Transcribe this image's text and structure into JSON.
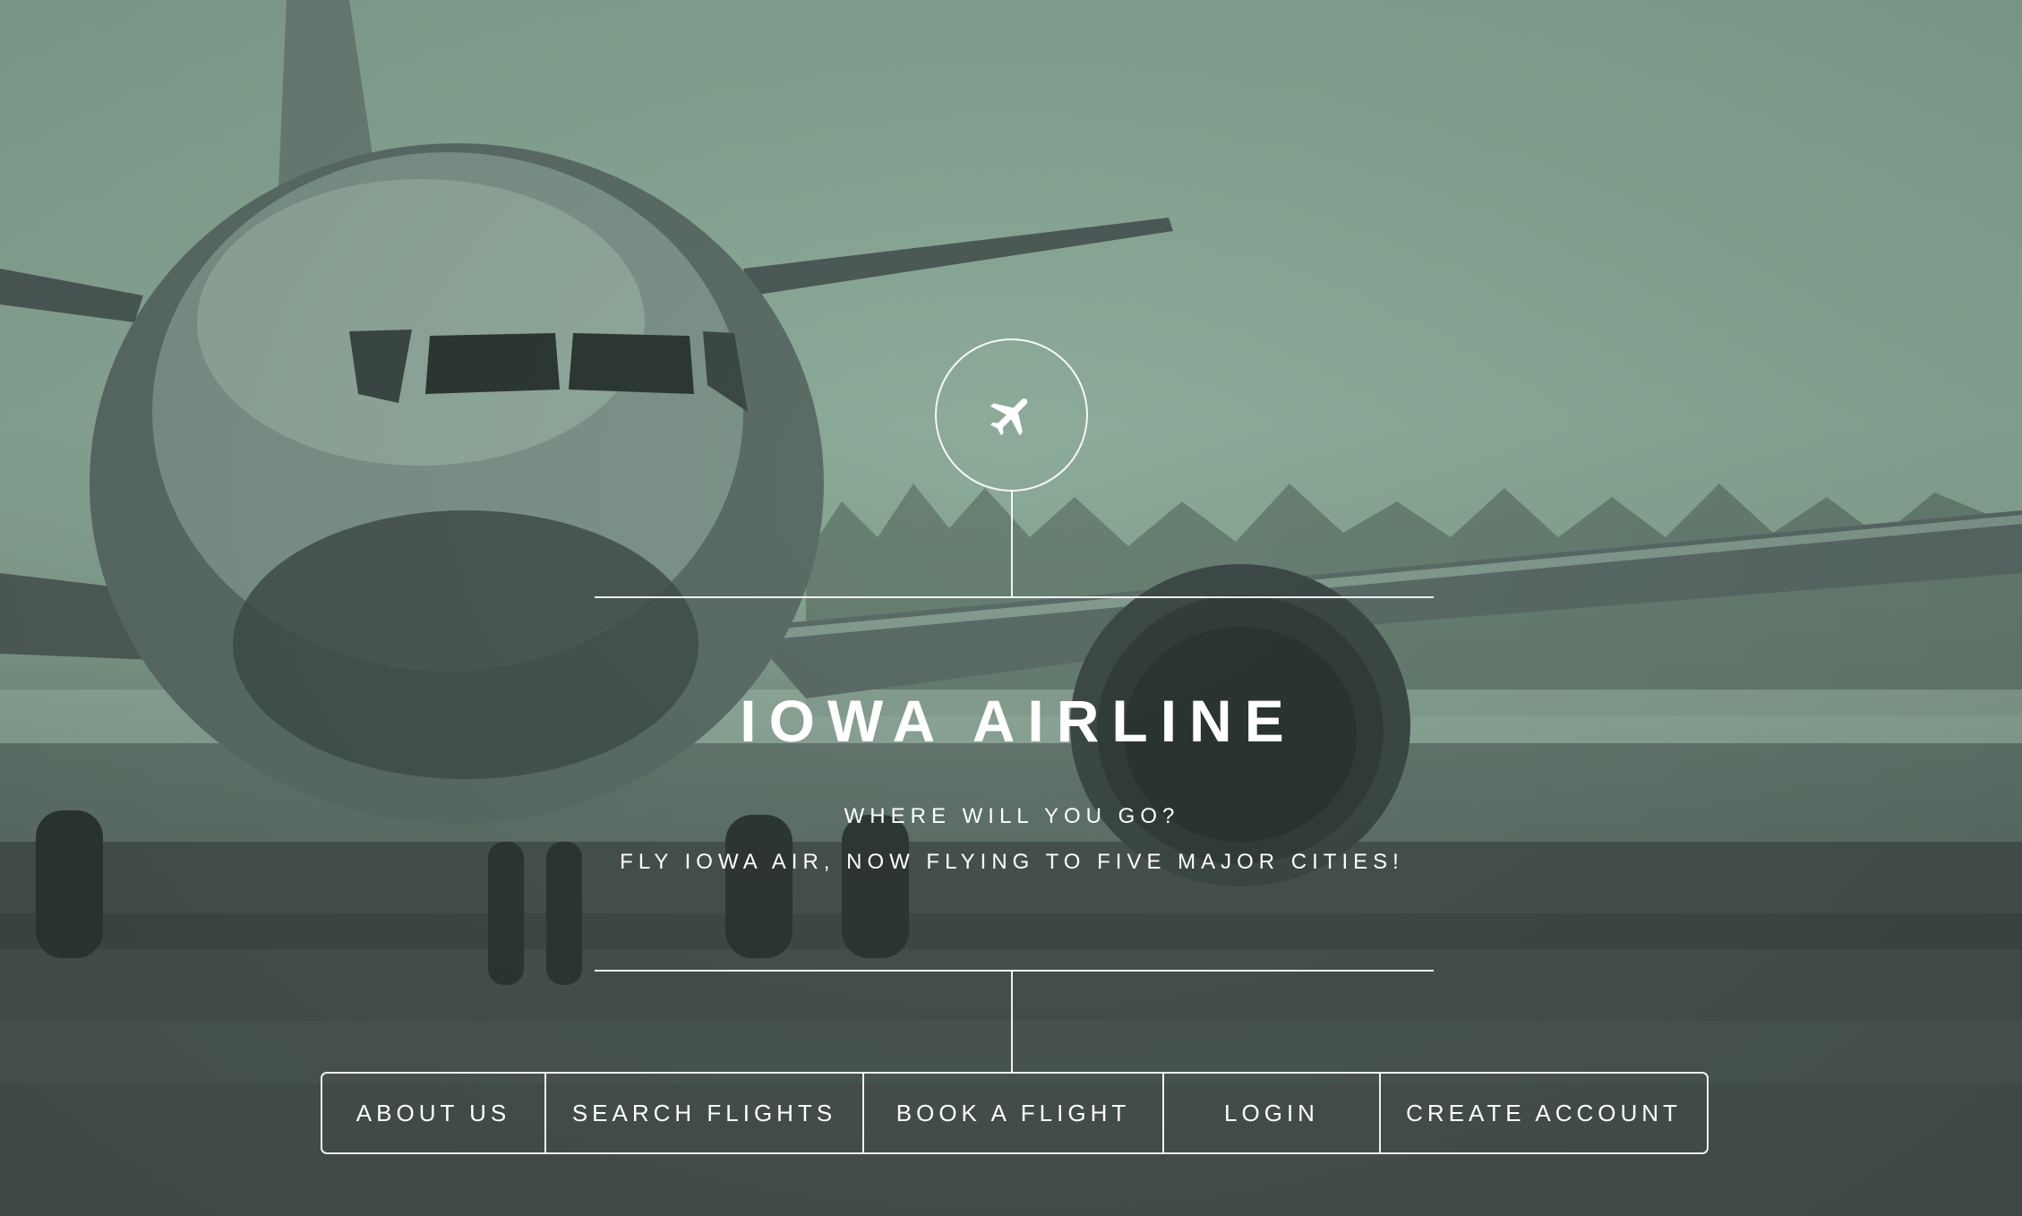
{
  "brand": {
    "logo_icon": "airplane-icon",
    "title": "IOWA AIRLINE",
    "tagline_line1": "WHERE WILL YOU GO?",
    "tagline_line2": "FLY IOWA AIR, NOW FLYING TO FIVE MAJOR CITIES!"
  },
  "nav": {
    "items": [
      {
        "label": "ABOUT US"
      },
      {
        "label": "SEARCH FLIGHTS"
      },
      {
        "label": "BOOK A FLIGHT"
      },
      {
        "label": "LOGIN"
      },
      {
        "label": "CREATE ACCOUNT"
      }
    ]
  },
  "colors": {
    "overlay_tint": "#86a593",
    "line_color": "#ffffff",
    "text_color": "#ffffff"
  }
}
